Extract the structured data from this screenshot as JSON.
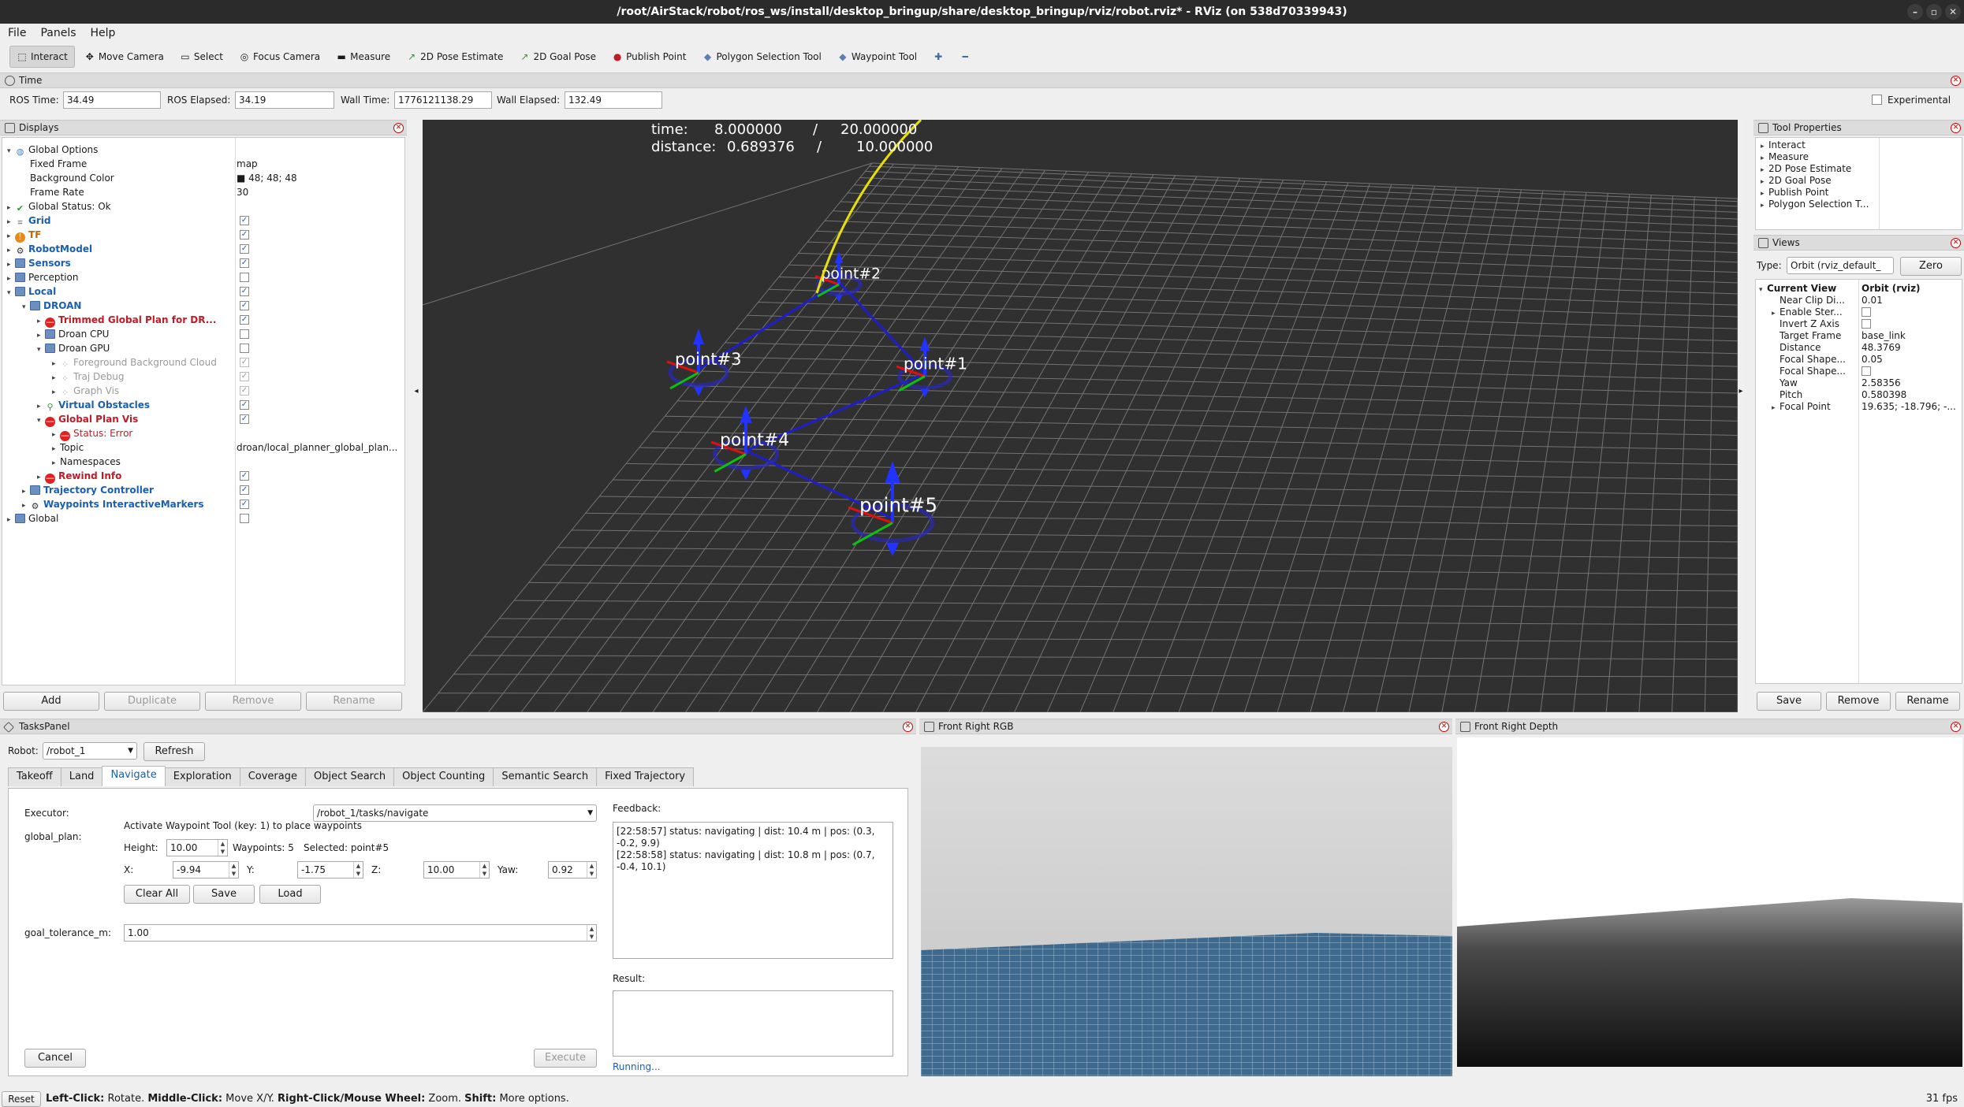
{
  "window": {
    "title": "/root/AirStack/robot/ros_ws/install/desktop_bringup/share/desktop_bringup/rviz/robot.rviz* - RViz (on 538d70339943)",
    "min": "–",
    "restore": "▫",
    "close": "✕"
  },
  "menu": [
    "File",
    "Panels",
    "Help"
  ],
  "toolbar": {
    "tools": [
      {
        "label": "Interact",
        "icon": "interact-icon",
        "glyph": "⬚"
      },
      {
        "label": "Move Camera",
        "icon": "move-camera-icon",
        "glyph": "✥"
      },
      {
        "label": "Select",
        "icon": "select-icon",
        "glyph": "▭"
      },
      {
        "label": "Focus Camera",
        "icon": "focus-camera-icon",
        "glyph": "◎"
      },
      {
        "label": "Measure",
        "icon": "measure-icon",
        "glyph": "▬"
      },
      {
        "label": "2D Pose Estimate",
        "icon": "pose-estimate-icon",
        "glyph": "↗"
      },
      {
        "label": "2D Goal Pose",
        "icon": "goal-pose-icon",
        "glyph": "↗"
      },
      {
        "label": "Publish Point",
        "icon": "publish-point-icon",
        "glyph": "●"
      },
      {
        "label": "Polygon Selection Tool",
        "icon": "polygon-selection-icon",
        "glyph": "◆"
      },
      {
        "label": "Waypoint Tool",
        "icon": "waypoint-tool-icon",
        "glyph": "◆"
      }
    ],
    "plus": "✚",
    "minus": "━"
  },
  "time": {
    "title": "Time",
    "ros_time_label": "ROS Time:",
    "ros_time": "34.49",
    "ros_elapsed_label": "ROS Elapsed:",
    "ros_elapsed": "34.19",
    "wall_time_label": "Wall Time:",
    "wall_time": "1776121138.29",
    "wall_elapsed_label": "Wall Elapsed:",
    "wall_elapsed": "132.49",
    "experimental": "Experimental"
  },
  "displays": {
    "title": "Displays",
    "rows": [
      {
        "d": 0,
        "exp": "▾",
        "icon": "globe",
        "name": "Global Options",
        "cls": "",
        "val": "",
        "cb": null
      },
      {
        "d": 1,
        "exp": "",
        "icon": "",
        "name": "Fixed Frame",
        "cls": "",
        "val": "map",
        "cb": null
      },
      {
        "d": 1,
        "exp": "",
        "icon": "",
        "name": "Background Color",
        "cls": "",
        "val": "■ 48; 48; 48",
        "cb": null
      },
      {
        "d": 1,
        "exp": "",
        "icon": "",
        "name": "Frame Rate",
        "cls": "",
        "val": "30",
        "cb": null
      },
      {
        "d": 0,
        "exp": "▸",
        "icon": "check",
        "name": "Global Status: Ok",
        "cls": "",
        "val": "",
        "cb": null
      },
      {
        "d": 0,
        "exp": "▸",
        "icon": "grid",
        "name": "Grid",
        "cls": "blue",
        "val": "",
        "cb": "on"
      },
      {
        "d": 0,
        "exp": "▸",
        "icon": "warn",
        "name": "TF",
        "cls": "orange",
        "val": "",
        "cb": "on"
      },
      {
        "d": 0,
        "exp": "▸",
        "icon": "robot",
        "name": "RobotModel",
        "cls": "blue",
        "val": "",
        "cb": "on"
      },
      {
        "d": 0,
        "exp": "▸",
        "icon": "folder",
        "name": "Sensors",
        "cls": "blue",
        "val": "",
        "cb": "on"
      },
      {
        "d": 0,
        "exp": "▸",
        "icon": "folder",
        "name": "Perception",
        "cls": "",
        "val": "",
        "cb": "off"
      },
      {
        "d": 0,
        "exp": "▾",
        "icon": "folder",
        "name": "Local",
        "cls": "blue",
        "val": "",
        "cb": "on"
      },
      {
        "d": 1,
        "exp": "▾",
        "icon": "folder",
        "name": "DROAN",
        "cls": "blue",
        "val": "",
        "cb": "on"
      },
      {
        "d": 2,
        "exp": "▸",
        "icon": "error",
        "name": "Trimmed Global Plan for DR...",
        "cls": "red",
        "val": "",
        "cb": "on"
      },
      {
        "d": 2,
        "exp": "▸",
        "icon": "folder",
        "name": "Droan CPU",
        "cls": "",
        "val": "",
        "cb": "off"
      },
      {
        "d": 2,
        "exp": "▾",
        "icon": "folder",
        "name": "Droan GPU",
        "cls": "",
        "val": "",
        "cb": "off"
      },
      {
        "d": 3,
        "exp": "▸",
        "icon": "cloud",
        "name": "Foreground Background Cloud",
        "cls": "gray",
        "val": "",
        "cb": "dim"
      },
      {
        "d": 3,
        "exp": "▸",
        "icon": "dots",
        "name": "Traj Debug",
        "cls": "gray",
        "val": "",
        "cb": "dim"
      },
      {
        "d": 3,
        "exp": "▸",
        "icon": "dots",
        "name": "Graph Vis",
        "cls": "gray",
        "val": "",
        "cb": "dim"
      },
      {
        "d": 2,
        "exp": "▸",
        "icon": "marker",
        "name": "Virtual Obstacles",
        "cls": "blue",
        "val": "",
        "cb": "on"
      },
      {
        "d": 2,
        "exp": "▾",
        "icon": "error",
        "name": "Global Plan Vis",
        "cls": "red",
        "val": "",
        "cb": "on"
      },
      {
        "d": 3,
        "exp": "▸",
        "icon": "error",
        "name": "Status: Error",
        "cls": "redplain",
        "val": "",
        "cb": null
      },
      {
        "d": 3,
        "exp": "▸",
        "icon": "",
        "name": "Topic",
        "cls": "",
        "val": "droan/local_planner_global_plan...",
        "cb": null
      },
      {
        "d": 3,
        "exp": "▸",
        "icon": "",
        "name": "Namespaces",
        "cls": "",
        "val": "",
        "cb": null
      },
      {
        "d": 2,
        "exp": "▸",
        "icon": "error",
        "name": "Rewind Info",
        "cls": "red",
        "val": "",
        "cb": "on"
      },
      {
        "d": 1,
        "exp": "▸",
        "icon": "folder",
        "name": "Trajectory Controller",
        "cls": "blue",
        "val": "",
        "cb": "on"
      },
      {
        "d": 1,
        "exp": "▸",
        "icon": "robot",
        "name": "Waypoints InteractiveMarkers",
        "cls": "blue",
        "val": "",
        "cb": "on"
      },
      {
        "d": 0,
        "exp": "▸",
        "icon": "folder",
        "name": "Global",
        "cls": "",
        "val": "",
        "cb": "off"
      }
    ],
    "add": "Add",
    "duplicate": "Duplicate",
    "remove": "Remove",
    "rename": "Rename"
  },
  "viewport": {
    "hud_time_label": "time:",
    "hud_time": "8.000000",
    "hud_time_slash": "/",
    "hud_time_total": "20.000000",
    "hud_dist_label": "distance:",
    "hud_dist": "0.689376",
    "hud_dist_slash": "/",
    "hud_dist_total": "10.000000",
    "points": [
      "point#1",
      "point#2",
      "point#3",
      "point#4",
      "point#5"
    ],
    "left_arrow": "◂",
    "right_arrow": "▸"
  },
  "tool_properties": {
    "title": "Tool Properties",
    "items": [
      "Interact",
      "Measure",
      "2D Pose Estimate",
      "2D Goal Pose",
      "Publish Point",
      "Polygon Selection T..."
    ]
  },
  "views": {
    "title": "Views",
    "type_label": "Type:",
    "type_value": "Orbit (rviz_default_",
    "zero": "Zero",
    "rows": [
      {
        "n": "Current View",
        "v": "Orbit (rviz)",
        "bold": true,
        "exp": "▾"
      },
      {
        "n": "Near Clip Di...",
        "v": "0.01",
        "exp": ""
      },
      {
        "n": "Enable Ster...",
        "v": "",
        "cb": true,
        "exp": "▸"
      },
      {
        "n": "Invert Z Axis",
        "v": "",
        "cb": true,
        "exp": ""
      },
      {
        "n": "Target Frame",
        "v": "base_link",
        "exp": ""
      },
      {
        "n": "Distance",
        "v": "48.3769",
        "exp": ""
      },
      {
        "n": "Focal Shape...",
        "v": "0.05",
        "exp": ""
      },
      {
        "n": "Focal Shape...",
        "v": "",
        "cb": true,
        "exp": ""
      },
      {
        "n": "Yaw",
        "v": "2.58356",
        "exp": ""
      },
      {
        "n": "Pitch",
        "v": "0.580398",
        "exp": ""
      },
      {
        "n": "Focal Point",
        "v": "19.635; -18.796; -...",
        "exp": "▸"
      }
    ],
    "save": "Save",
    "remove": "Remove",
    "rename": "Rename"
  },
  "tasks": {
    "title": "TasksPanel",
    "robot_label": "Robot:",
    "robot": "/robot_1",
    "refresh": "Refresh",
    "tabs": [
      "Takeoff",
      "Land",
      "Navigate",
      "Exploration",
      "Coverage",
      "Object Search",
      "Object Counting",
      "Semantic Search",
      "Fixed Trajectory"
    ],
    "selected_tab": "Navigate",
    "executor_label": "Executor:",
    "executor": "/robot_1/tasks/navigate",
    "global_plan_label": "global_plan:",
    "hint": "Activate Waypoint Tool (key: 1) to place waypoints",
    "height_label": "Height:",
    "height": "10.00",
    "waypoints": "Waypoints: 5",
    "selected": "Selected: point#5",
    "x_label": "X:",
    "x": "-9.94",
    "y_label": "Y:",
    "y": "-1.75",
    "z_label": "Z:",
    "z": "10.00",
    "yaw_label": "Yaw:",
    "yaw": "0.92",
    "clear_all": "Clear All",
    "save": "Save",
    "load": "Load",
    "goal_tol_label": "goal_tolerance_m:",
    "goal_tol": "1.00",
    "feedback_label": "Feedback:",
    "feedback": "[22:58:57] status: navigating | dist: 10.4 m | pos: (0.3, -0.2, 9.9)\n[22:58:58] status: navigating | dist: 10.8 m | pos: (0.7, -0.4, 10.1)",
    "result_label": "Result:",
    "running": "Running...",
    "cancel": "Cancel",
    "execute": "Execute"
  },
  "cam_rgb": {
    "title": "Front Right RGB"
  },
  "cam_depth": {
    "title": "Front Right Depth"
  },
  "status": {
    "reset": "Reset",
    "b1": "Left-Click:",
    "t1": " Rotate. ",
    "b2": "Middle-Click:",
    "t2": " Move X/Y. ",
    "b3": "Right-Click/Mouse Wheel:",
    "t3": " Zoom. ",
    "b4": "Shift:",
    "t4": " More options.",
    "fps": "31 fps"
  }
}
